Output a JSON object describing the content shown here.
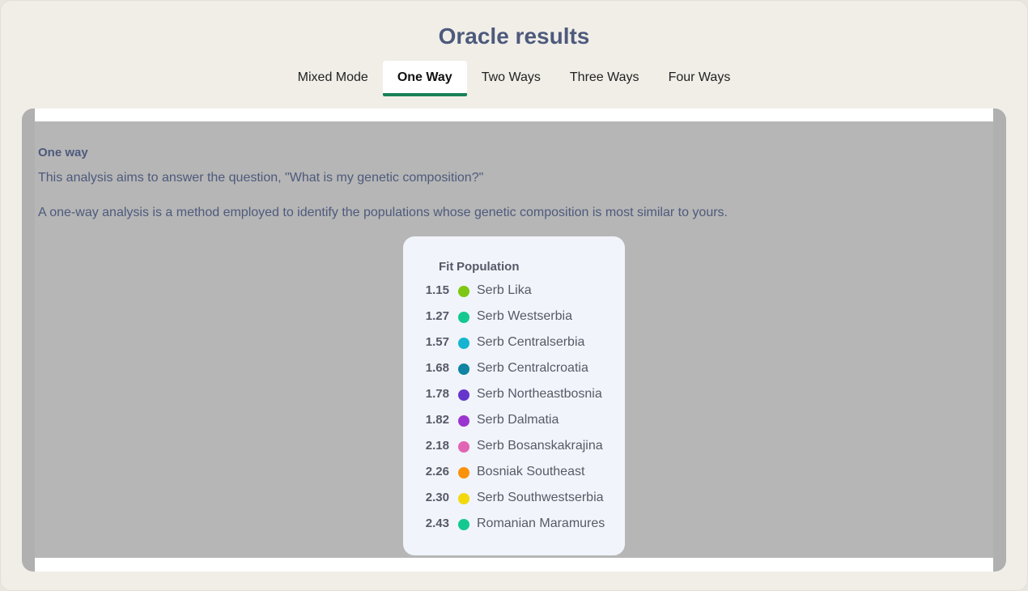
{
  "header": {
    "title": "Oracle results"
  },
  "tabs": [
    {
      "label": "Mixed Mode",
      "active": false
    },
    {
      "label": "One Way",
      "active": true
    },
    {
      "label": "Two Ways",
      "active": false
    },
    {
      "label": "Three Ways",
      "active": false
    },
    {
      "label": "Four Ways",
      "active": false
    }
  ],
  "main": {
    "section_title": "One way",
    "paragraph1": "This analysis aims to answer the question, \"What is my genetic composition?\"",
    "paragraph2": "A one-way analysis is a method employed to identify the populations whose genetic composition is most similar to yours."
  },
  "results": {
    "headers": {
      "fit": "Fit",
      "population": "Population"
    },
    "rows": [
      {
        "fit": "1.15",
        "population": "Serb Lika",
        "color": "#7ec713"
      },
      {
        "fit": "1.27",
        "population": "Serb Westserbia",
        "color": "#14c98f"
      },
      {
        "fit": "1.57",
        "population": "Serb Centralserbia",
        "color": "#16b4d0"
      },
      {
        "fit": "1.68",
        "population": "Serb Centralcroatia",
        "color": "#0f84a3"
      },
      {
        "fit": "1.78",
        "population": "Serb Northeastbosnia",
        "color": "#6636cc"
      },
      {
        "fit": "1.82",
        "population": "Serb Dalmatia",
        "color": "#9b35cf"
      },
      {
        "fit": "2.18",
        "population": "Serb Bosanskakrajina",
        "color": "#e264b5"
      },
      {
        "fit": "2.26",
        "population": "Bosniak Southeast",
        "color": "#fb920c"
      },
      {
        "fit": "2.30",
        "population": "Serb Southwestserbia",
        "color": "#f2d90c"
      },
      {
        "fit": "2.43",
        "population": "Romanian Maramures",
        "color": "#14c98f"
      }
    ]
  }
}
